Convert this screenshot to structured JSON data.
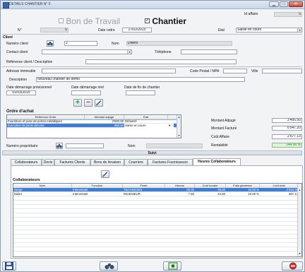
{
  "window": {
    "title": "DETAILS CHANTIER N° 5",
    "minimize_glyph": "▁",
    "maximize_glyph": "▭",
    "close_glyph": "✕"
  },
  "header": {
    "id_affaire_label": "Id affaire",
    "id_affaire_value": "5",
    "bon_travail_label": "Bon de Travail",
    "chantier_label": "Chantier",
    "chantier_checked_glyph": "✓",
    "numero_label": "N°",
    "numero_value": "5",
    "date_ordre_label": "Date ordre",
    "date_ordre_value": "17/02/2015",
    "etat_label": "Etat",
    "etat_value": "Saisie en cours"
  },
  "client": {
    "section_label": "Client",
    "numero_client_label": "Numéro client",
    "numero_client_value": "2",
    "nom_label": "Nom",
    "nom_value": "Divers",
    "contact_label": "Contact client",
    "contact_value": "",
    "telephone_label": "Téléphone",
    "telephone_value": "",
    "reference_label": "Référence client / Description",
    "reference_value": ""
  },
  "adresse": {
    "adresse_label": "Adresse immeuble",
    "adresse_value": "",
    "cp_label": "Code Postal / NPA",
    "cp_value": "",
    "ville_label": "Ville",
    "ville_value": "",
    "description_label": "Description",
    "description_value": "Nouveau chantier de demo"
  },
  "dates": {
    "demarrage_prev_label": "Date démarrage prévisionnel",
    "demarrage_prev_value": "01/03/2015",
    "demarrage_reel_label": "Date démarrage réel",
    "demarrage_reel_value": "",
    "fin_label": "Date de fin de chantier",
    "fin_value": ""
  },
  "ordre_achat": {
    "title": "Ordre d'achat",
    "add_glyph": "+",
    "remove_glyph": "−",
    "columns": [
      "Référence Ordre",
      "Montant adjugé",
      "Etat"
    ],
    "rows": [
      {
        "ref": "Fourniture et pose de portes métalliques",
        "montant": "2'500.00",
        "etat": "Démarré"
      },
      {
        "ref": "Execution de joints silicone",
        "montant": "956.50",
        "etat": "Saisie en cours"
      }
    ]
  },
  "totaux": {
    "adjuge_label": "Montant Adjugé",
    "adjuge_value": "3'456.50",
    "facture_label": "Montant Facturé",
    "facture_value": "6'547.20",
    "cout_label": "Coût Affaire",
    "cout_value": "2'677.13",
    "rentabilite_label": "Rentabilité",
    "rentabilite_value": "144.56 %"
  },
  "proprietaire": {
    "numero_label": "Numéro propriétaire",
    "numero_value": "",
    "nom_label": "Nom",
    "nom_value": ""
  },
  "suivi_label": "Suivi",
  "tabs": [
    {
      "label": "Collaborateurs"
    },
    {
      "label": "Devis"
    },
    {
      "label": "Factures Clients"
    },
    {
      "label": "Bons de livraison"
    },
    {
      "label": "Courriers"
    },
    {
      "label": "Factures Fournisseurs"
    },
    {
      "label": "Heures Collaborateurs"
    }
  ],
  "collaborateurs": {
    "title": "Collaborateurs",
    "columns": [
      "Nom",
      "Fonction",
      "Poste",
      "Heures",
      "Coût horaire",
      "Frais généraux",
      "Coût total"
    ],
    "rows": [
      {
        "nom": "Serge",
        "fonction": "Intervenant",
        "poste": "TECHNICIEN",
        "heures": "60.00",
        "cout_horaire": "35.00",
        "frais": "10.00 %",
        "total": "2'310.00"
      },
      {
        "nom": "Didier",
        "fonction": "Intervenant",
        "poste": "INGENIEUR",
        "heures": "7.50",
        "cout_horaire": "44.50",
        "frais": "10.00 %",
        "total": "367.13"
      }
    ]
  },
  "colors": {
    "selection": "#3e7ed6",
    "green_add": "#2c9b2c",
    "red_remove": "#c62d2d",
    "rentabilite_bg": "#dff5d9",
    "rentabilite_text": "#2f8a2a"
  }
}
